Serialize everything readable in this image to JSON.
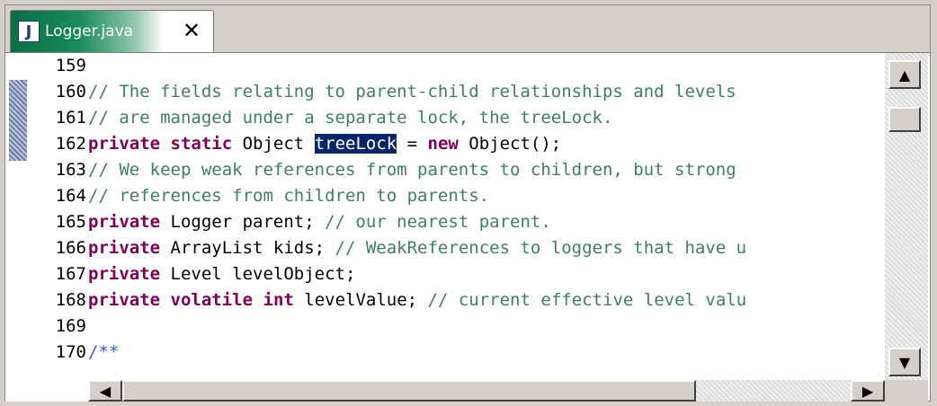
{
  "tab": {
    "icon_letter": "J",
    "filename": "Logger.java",
    "close_glyph": "✕"
  },
  "editor": {
    "lines": [
      {
        "num": "159",
        "parts": []
      },
      {
        "num": "160",
        "parts": [
          {
            "t": "cm",
            "text": "// The fields relating to parent-child relationships and levels"
          }
        ]
      },
      {
        "num": "161",
        "parts": [
          {
            "t": "cm",
            "text": "// are managed under a separate lock, the treeLock."
          }
        ]
      },
      {
        "num": "162",
        "parts": [
          {
            "t": "kw",
            "text": "private"
          },
          {
            "t": "",
            "text": " "
          },
          {
            "t": "kw",
            "text": "static"
          },
          {
            "t": "",
            "text": " Object "
          },
          {
            "t": "sel",
            "text": "treeLock"
          },
          {
            "t": "",
            "text": " = "
          },
          {
            "t": "kw",
            "text": "new"
          },
          {
            "t": "",
            "text": " Object();"
          }
        ]
      },
      {
        "num": "163",
        "parts": [
          {
            "t": "cm",
            "text": "// We keep weak references from parents to children, but strong"
          }
        ]
      },
      {
        "num": "164",
        "parts": [
          {
            "t": "cm",
            "text": "// references from children to parents."
          }
        ]
      },
      {
        "num": "165",
        "parts": [
          {
            "t": "kw",
            "text": "private"
          },
          {
            "t": "",
            "text": " Logger parent; "
          },
          {
            "t": "cm",
            "text": "// our nearest parent."
          }
        ]
      },
      {
        "num": "166",
        "parts": [
          {
            "t": "kw",
            "text": "private"
          },
          {
            "t": "",
            "text": " ArrayList kids; "
          },
          {
            "t": "cm",
            "text": "// WeakReferences to loggers that have u"
          }
        ]
      },
      {
        "num": "167",
        "parts": [
          {
            "t": "kw",
            "text": "private"
          },
          {
            "t": "",
            "text": " Level levelObject;"
          }
        ]
      },
      {
        "num": "168",
        "parts": [
          {
            "t": "kw",
            "text": "private"
          },
          {
            "t": "",
            "text": " "
          },
          {
            "t": "kw",
            "text": "volatile"
          },
          {
            "t": "",
            "text": " "
          },
          {
            "t": "kw",
            "text": "int"
          },
          {
            "t": "",
            "text": " levelValue; "
          },
          {
            "t": "cm",
            "text": "// current effective level valu"
          }
        ]
      },
      {
        "num": "169",
        "parts": []
      },
      {
        "num": "170",
        "parts": [
          {
            "t": "jd",
            "text": "/**"
          }
        ]
      }
    ]
  },
  "scrollbars": {
    "up_arrow": "▲",
    "down_arrow": "▼",
    "left_arrow": "◀",
    "right_arrow": "▶"
  }
}
